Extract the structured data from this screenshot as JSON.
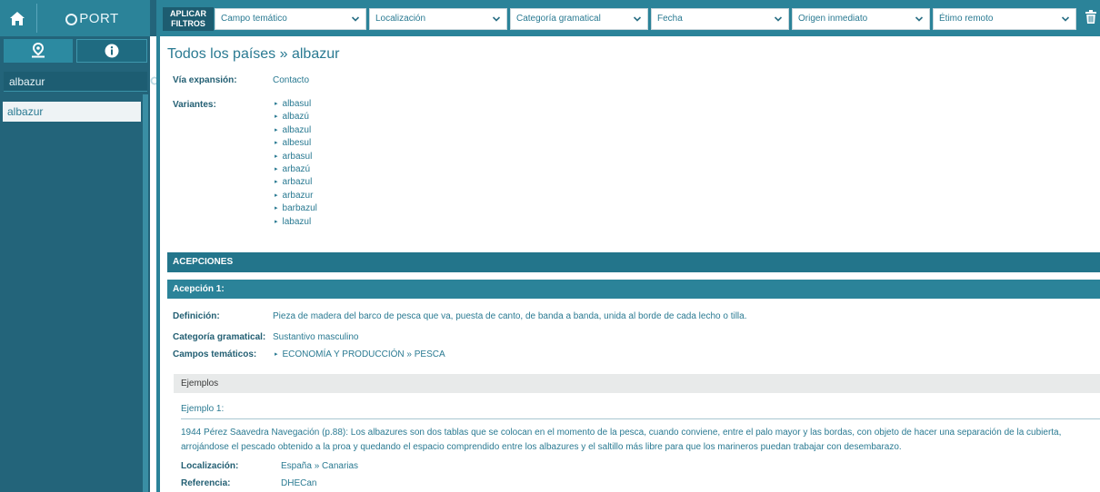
{
  "sidebar": {
    "logo_text": "PORT",
    "search": {
      "value": "albazur"
    },
    "result_item": "albazur"
  },
  "filters": {
    "apply_line1": "APLICAR",
    "apply_line2": "FILTROS",
    "items": [
      "Campo temático",
      "Localización",
      "Categoría gramatical",
      "Fecha",
      "Origen inmediato",
      "Étimo remoto"
    ]
  },
  "entry": {
    "title": "Todos los países » albazur",
    "via_label": "Vía expansión:",
    "via_value": "Contacto",
    "variants_label": "Variantes:",
    "variants": [
      "albasul",
      "albazú",
      "albazul",
      "albesul",
      "arbasul",
      "arbazú",
      "arbazul",
      "arbazur",
      "barbazul",
      "labazul"
    ],
    "acepciones_header": "ACEPCIONES",
    "acepcion_title": "Acepción 1:",
    "definicion_label": "Definición:",
    "definicion_value": "Pieza de madera del barco de pesca que va, puesta de canto, de banda a banda, unida al borde de cada lecho o tilla.",
    "categoria_label": "Categoría gramatical:",
    "categoria_value": "Sustantivo masculino",
    "campos_label": "Campos temáticos:",
    "campos_value": "ECONOMÍA Y PRODUCCIÓN » PESCA",
    "ejemplos_header": "Ejemplos",
    "ejemplo_title": "Ejemplo 1:",
    "ejemplo_text": "1944 Pérez Saavedra Navegación (p.88): Los albazures son dos tablas que se colocan en el momento de la pesca, cuando conviene, entre el palo mayor y las bordas, con objeto de hacer una separación de la cubierta, arrojándose el pescado obtenido a la proa y quedando el espacio comprendido entre los albazures y el saltillo más libre para que los marineros puedan trabajar con desembarazo.",
    "localizacion_label": "Localización:",
    "localizacion_value": "España » Canarias",
    "referencia_label": "Referencia:",
    "referencia_value": "DHECan"
  },
  "colors": {
    "accent": "#2b8399",
    "sidebar": "#23647a",
    "text": "#2a7a92"
  }
}
